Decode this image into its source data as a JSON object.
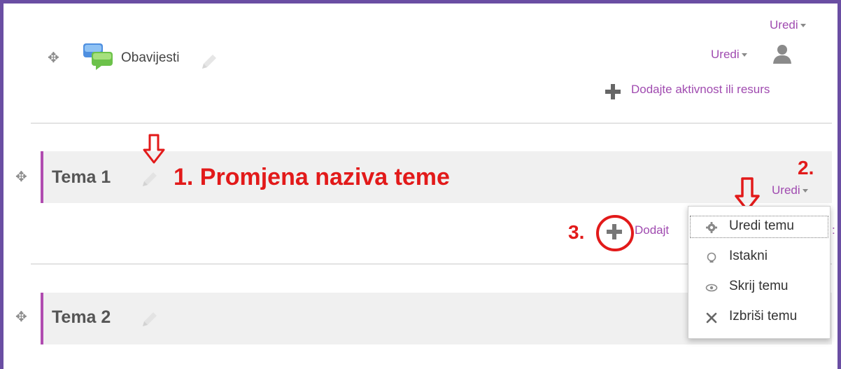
{
  "announcements": {
    "label": "Obavijesti",
    "top_edit": "Uredi",
    "user_edit": "Uredi",
    "add_activity": "Dodajte aktivnost ili resurs"
  },
  "sections": [
    {
      "title": "Tema 1",
      "edit": "Uredi",
      "add_activity_partial": "Dodajt"
    },
    {
      "title": "Tema 2"
    }
  ],
  "annotations": {
    "step1": "1. Promjena naziva teme",
    "step2": "2.",
    "step3": "3."
  },
  "edit_menu": {
    "items": [
      {
        "label": "Uredi temu",
        "icon": "gear-icon"
      },
      {
        "label": "Istakni",
        "icon": "lightbulb-icon"
      },
      {
        "label": "Skrij temu",
        "icon": "eye-icon"
      },
      {
        "label": "Izbriši temu",
        "icon": "cross-icon"
      }
    ]
  },
  "colors": {
    "frame": "#6a4ea3",
    "link": "#a04bb0",
    "annotation": "#e21a1a",
    "section_accent": "#b04cb0"
  }
}
